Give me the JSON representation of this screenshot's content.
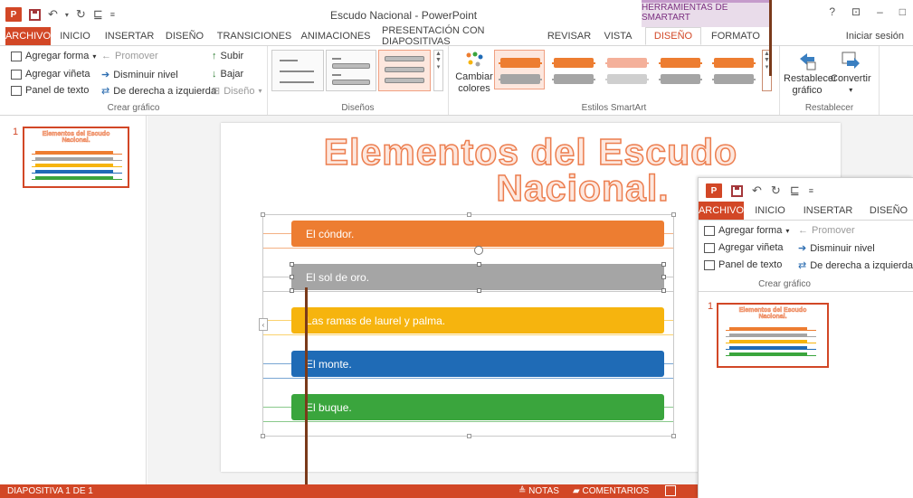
{
  "window": {
    "title": "Escudo Nacional - PowerPoint",
    "context_tab_header": "HERRAMIENTAS DE SMARTART",
    "help": "?",
    "controls": [
      "⊡",
      "–",
      "□"
    ]
  },
  "tabs": [
    {
      "label": "ARCHIVO"
    },
    {
      "label": "INICIO"
    },
    {
      "label": "INSERTAR"
    },
    {
      "label": "DISEÑO"
    },
    {
      "label": "TRANSICIONES"
    },
    {
      "label": "ANIMACIONES"
    },
    {
      "label": "PRESENTACIÓN CON DIAPOSITIVAS"
    },
    {
      "label": "REVISAR"
    },
    {
      "label": "VISTA"
    },
    {
      "label": "DISEÑO"
    },
    {
      "label": "FORMATO"
    }
  ],
  "signin": "Iniciar sesión",
  "ribbon": {
    "crear_grafico": {
      "label": "Crear gráfico",
      "agregar_forma": "Agregar forma",
      "agregar_vineta": "Agregar viñeta",
      "panel_de_texto": "Panel de texto",
      "promover": "Promover",
      "disminuir_nivel": "Disminuir nivel",
      "derecha_izquierda": "De derecha a izquierda",
      "subir": "Subir",
      "bajar": "Bajar",
      "diseno": "Diseño"
    },
    "disenos": {
      "label": "Diseños"
    },
    "estilos": {
      "label": "Estilos SmartArt",
      "cambiar_colores": "Cambiar colores"
    },
    "restablecer": {
      "label": "Restablecer",
      "restablecer_grafico": "Restablecer gráfico",
      "convertir": "Convertir"
    }
  },
  "thumbnail": {
    "number": "1"
  },
  "slide": {
    "title_line1": "Elementos del Escudo",
    "title_line2": "Nacional.",
    "items": [
      {
        "text": "El cóndor.",
        "color": "#ed7d31"
      },
      {
        "text": "El sol de oro.",
        "color": "#a5a5a5"
      },
      {
        "text": "Las ramas de laurel y palma.",
        "color": "#f6b40e"
      },
      {
        "text": "El monte.",
        "color": "#1f6bb6"
      },
      {
        "text": "El buque.",
        "color": "#3aa53d"
      }
    ]
  },
  "status": {
    "slide_counter": "DIAPOSITIVA 1 DE 1",
    "notes": "NOTAS",
    "comments": "COMENTARIOS"
  },
  "inset": {
    "tabs": [
      "ARCHIVO",
      "INICIO",
      "INSERTAR",
      "DISEÑO"
    ],
    "agregar_forma": "Agregar forma",
    "promover": "Promover",
    "agregar_vineta": "Agregar viñeta",
    "disminuir_nivel": "Disminuir nivel",
    "panel_de_texto": "Panel de texto",
    "derecha_izquierda": "De derecha a izquierda",
    "group_label": "Crear gráfico",
    "thumb_number": "1"
  },
  "colors": {
    "accent": "#d24726",
    "title_stroke": "#ec7e4f"
  }
}
